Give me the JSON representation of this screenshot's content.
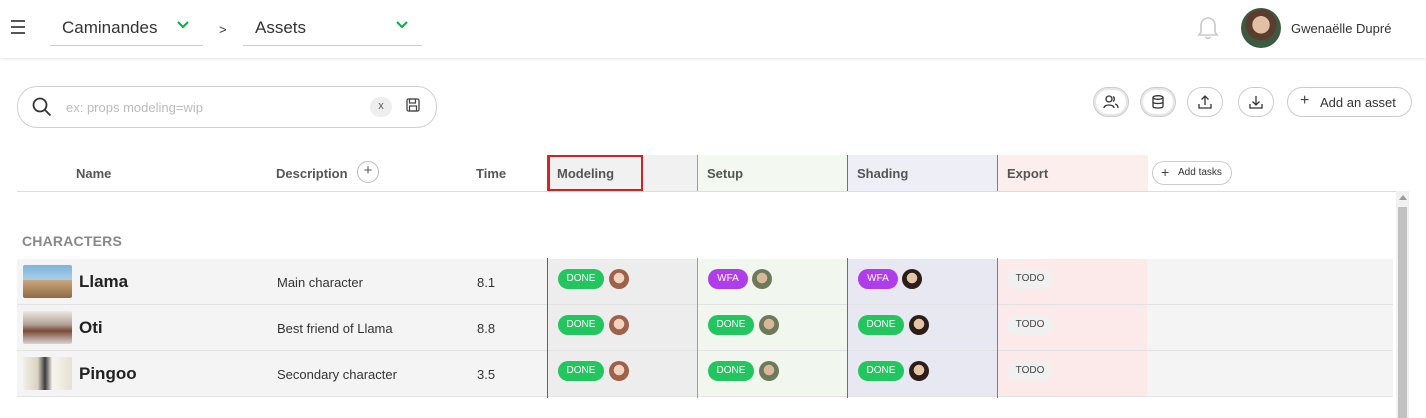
{
  "topbar": {
    "production": "Caminandes",
    "separator": ">",
    "section": "Assets",
    "username": "Gwenaëlle Dupré"
  },
  "search": {
    "placeholder": "ex: props modeling=wip",
    "value": "",
    "clear_label": "x"
  },
  "toolbar": {
    "add_asset_label": "Add an asset"
  },
  "table": {
    "headers": {
      "name": "Name",
      "description": "Description",
      "time": "Time",
      "add_tasks": "Add tasks"
    },
    "task_types": [
      {
        "name": "Modeling",
        "color": "#3b5bdb"
      },
      {
        "name": "Setup",
        "color": "#7bc043"
      },
      {
        "name": "Shading",
        "color": "#5c6bc0"
      },
      {
        "name": "Export",
        "color": "#e05555"
      }
    ],
    "section": "CHARACTERS",
    "rows": [
      {
        "name": "Llama",
        "description": "Main character",
        "time": "8.1",
        "statuses": [
          "DONE",
          "WFA",
          "WFA",
          "TODO"
        ]
      },
      {
        "name": "Oti",
        "description": "Best friend of Llama",
        "time": "8.8",
        "statuses": [
          "DONE",
          "DONE",
          "DONE",
          "TODO"
        ]
      },
      {
        "name": "Pingoo",
        "description": "Secondary character",
        "time": "3.5",
        "statuses": [
          "DONE",
          "DONE",
          "DONE",
          "TODO"
        ]
      }
    ]
  },
  "colors": {
    "done": "#22c55e",
    "wfa": "#b03dea",
    "todo": "#f0f0f0",
    "accent": "#00b242"
  }
}
